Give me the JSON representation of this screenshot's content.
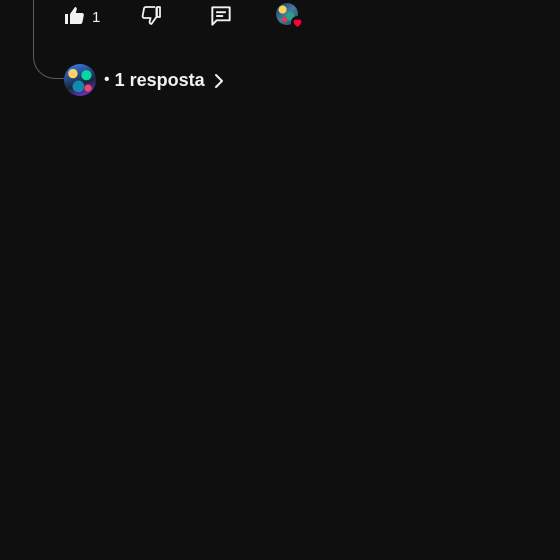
{
  "actions": {
    "like_count": "1",
    "like_icon": "thumbs-up-filled-icon",
    "dislike_icon": "thumbs-down-outline-icon",
    "reply_icon": "comment-icon",
    "heart_icon": "creator-heart-icon"
  },
  "replies": {
    "bullet": "•",
    "label": "1 resposta",
    "chevron_icon": "chevron-right-icon"
  },
  "colors": {
    "background": "#0f0f0f",
    "text": "#f1f1f1",
    "heart": "#ff0033",
    "thread_line": "#5a5a5a"
  }
}
